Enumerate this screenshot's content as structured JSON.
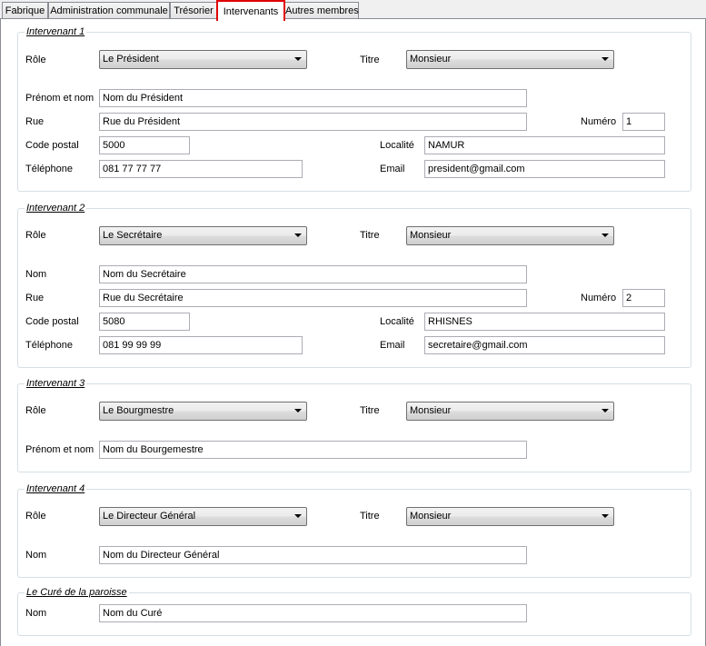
{
  "tabs": [
    "Fabrique",
    "Administration communale",
    "Trésorier",
    "Intervenants",
    "Autres membres"
  ],
  "labels": {
    "role": "Rôle",
    "titre": "Titre",
    "prenom_nom": "Prénom et nom",
    "nom": "Nom",
    "rue": "Rue",
    "numero": "Numéro",
    "code_postal": "Code postal",
    "localite": "Localité",
    "telephone": "Téléphone",
    "email": "Email"
  },
  "intervenant1": {
    "title": "Intervenant 1",
    "role": "Le Président",
    "titre": "Monsieur",
    "nom": "Nom du Président",
    "rue": "Rue du Président",
    "numero": "1",
    "code_postal": "5000",
    "localite": "NAMUR",
    "telephone": "081 77 77 77",
    "email": "president@gmail.com"
  },
  "intervenant2": {
    "title": "Intervenant 2",
    "role": "Le Secrétaire",
    "titre": "Monsieur",
    "nom": "Nom du Secrétaire",
    "rue": "Rue du Secrétaire",
    "numero": "2",
    "code_postal": "5080",
    "localite": "RHISNES",
    "telephone": "081 99 99 99",
    "email": "secretaire@gmail.com"
  },
  "intervenant3": {
    "title": "Intervenant 3",
    "role": "Le Bourgmestre",
    "titre": "Monsieur",
    "nom": "Nom du Bourgemestre"
  },
  "intervenant4": {
    "title": "Intervenant 4",
    "role": "Le Directeur Général",
    "titre": "Monsieur",
    "nom": "Nom du Directeur Général"
  },
  "cure": {
    "title": "Le Curé de la paroisse",
    "nom": "Nom du Curé"
  }
}
